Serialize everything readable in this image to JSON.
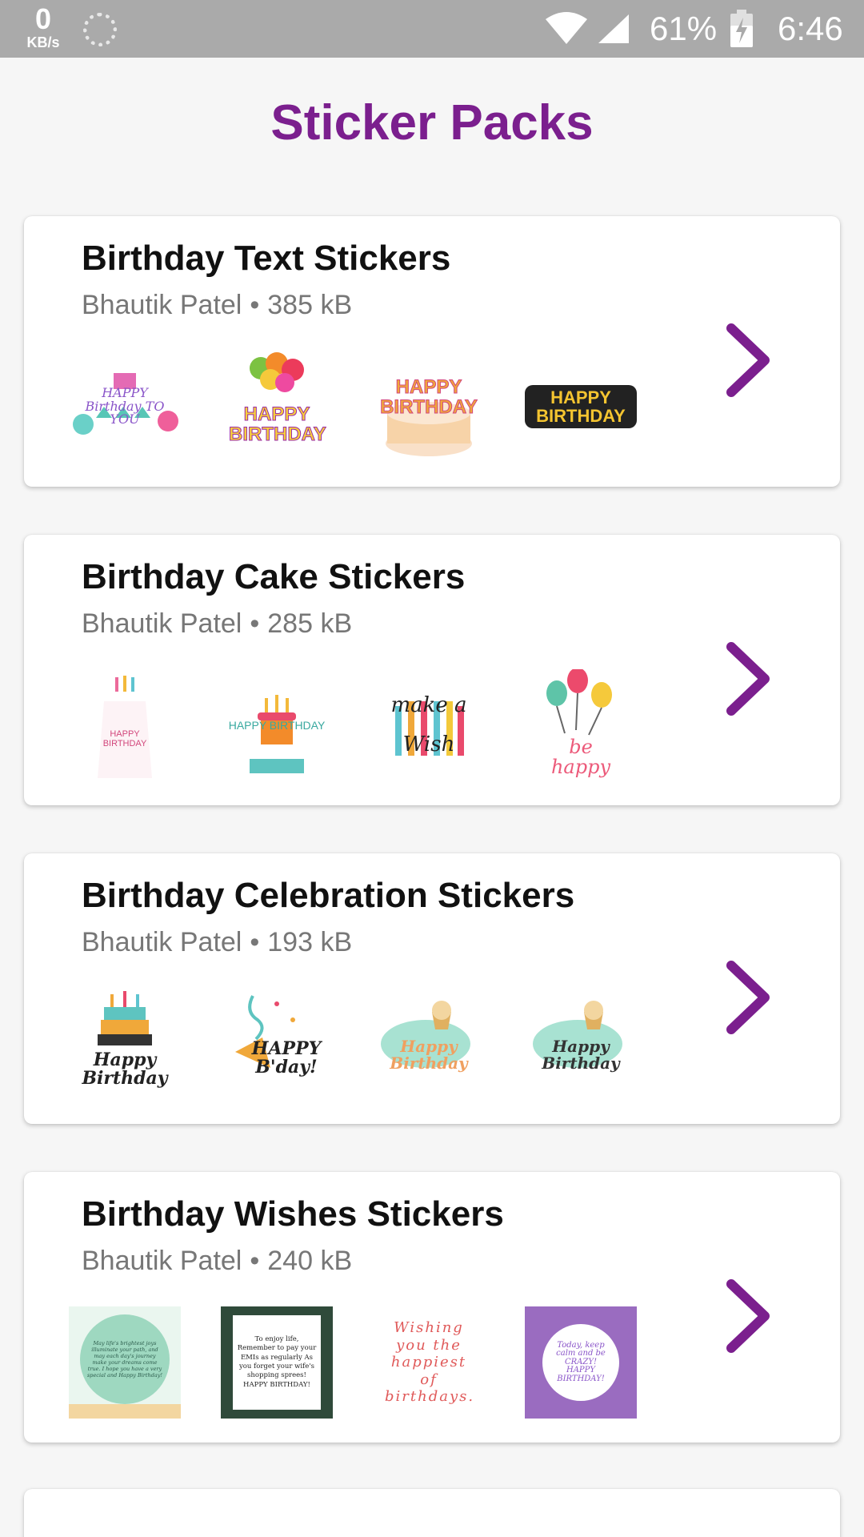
{
  "status_bar": {
    "net_speed_value": "0",
    "net_speed_unit": "KB/s",
    "battery_percent": "61%",
    "time": "6:46",
    "icons": [
      "sync-icon",
      "wifi-icon",
      "signal-icon",
      "battery-icon"
    ]
  },
  "header": {
    "title": "Sticker Packs"
  },
  "colors": {
    "accent": "#7b1f8e",
    "status_bar": "#aaaaaa",
    "background": "#f6f6f6"
  },
  "packs": [
    {
      "title": "Birthday Text Stickers",
      "publisher": "Bhautik Patel",
      "separator": "•",
      "size": "385 kB",
      "stickers": [
        "HAPPY Birthday TO YOU",
        "HAPPY BIRTHDAY",
        "HAPPY BIRTHDAY",
        "HAPPY BIRTHDAY"
      ]
    },
    {
      "title": "Birthday Cake Stickers",
      "publisher": "Bhautik Patel",
      "separator": "•",
      "size": "285 kB",
      "stickers": [
        "HAPPY BIRTHDAY",
        "HAPPY BIRTHDAY",
        "make a Wish",
        "be happy"
      ]
    },
    {
      "title": "Birthday Celebration Stickers",
      "publisher": "Bhautik Patel",
      "separator": "•",
      "size": "193 kB",
      "stickers": [
        "Happy Birthday",
        "HAPPY B'day!",
        "Happy Birthday",
        "Happy Birthday"
      ]
    },
    {
      "title": "Birthday Wishes Stickers",
      "publisher": "Bhautik Patel",
      "separator": "•",
      "size": "240 kB",
      "stickers": [
        "May life's brightest joys illuminate your path, and may each day's journey make your dreams come true. I hope you have a very special and Happy Birthday!",
        "To enjoy life, Remember to pay your EMIs as regularly As you forget your wife's shopping sprees! HAPPY BIRTHDAY!",
        "Wishing you the happiest of birthdays.",
        "Today, keep calm and be CRAZY! HAPPY BIRTHDAY!"
      ]
    }
  ]
}
